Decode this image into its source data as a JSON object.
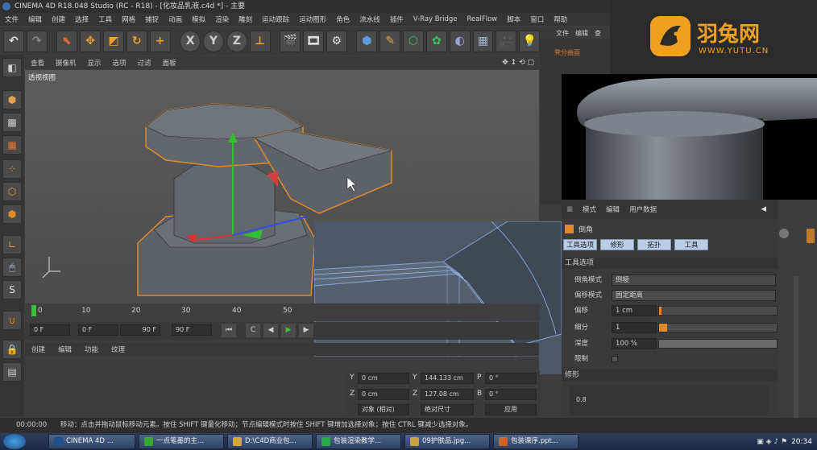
{
  "title": "CINEMA 4D R18.048 Studio (RC - R18) - [化妆品乳液.c4d *] - 主要",
  "menubar": [
    "文件",
    "编辑",
    "创建",
    "选择",
    "工具",
    "网格",
    "捕捉",
    "动画",
    "模拟",
    "渲染",
    "雕刻",
    "运动跟踪",
    "运动图形",
    "角色",
    "流水线",
    "插件",
    "V-Ray Bridge",
    "RealFlow",
    "脚本",
    "窗口",
    "帮助"
  ],
  "toolbar": {
    "axis_x": "X",
    "axis_y": "Y",
    "axis_z": "Z"
  },
  "viewport": {
    "menu": [
      "查看",
      "摄像机",
      "显示",
      "选项",
      "过滤",
      "面板"
    ],
    "label": "透视视图"
  },
  "timeline": {
    "ticks": [
      "0",
      "10",
      "20",
      "30",
      "40",
      "50"
    ],
    "start_frame": "0 F",
    "current_frame": "0 F",
    "range_end": "90 F",
    "end_frame": "90 F"
  },
  "material_bar": [
    "创建",
    "编辑",
    "功能",
    "纹理"
  ],
  "coords": {
    "y_pos": "144.133 cm",
    "z_pos": "127.08 cm",
    "y_size": "0 cm",
    "z_size": "0 cm",
    "p_rot": "0 °",
    "b_rot": "0 °",
    "y_label": "Y",
    "z_label": "Z",
    "p_label": "P",
    "b_label": "B",
    "mode_object": "对象 (相对)",
    "mode_size": "绝对尺寸",
    "apply": "应用"
  },
  "object_panel": {
    "menu": [
      "文件",
      "编辑",
      "查"
    ],
    "item": "凳分曲面"
  },
  "logo": {
    "name": "羽兔网",
    "url": "WWW.YUTU.CN"
  },
  "attributes": {
    "menu": [
      "模式",
      "编辑",
      "用户数据"
    ],
    "object_name": "倒角",
    "tabs": [
      "工具选项",
      "修形",
      "拓扑",
      "工具"
    ],
    "section": "工具选项",
    "bevel_mode_label": "倒角模式",
    "bevel_mode_value": "倒棱",
    "offset_mode_label": "偏移模式",
    "offset_mode_value": "固定距离",
    "offset_label": "偏移",
    "offset_value": "1 cm",
    "subdiv_label": "细分",
    "subdiv_value": "1",
    "depth_label": "深度",
    "depth_value": "100 %",
    "limit_label": "限制",
    "shape_section": "修形",
    "graph_tick": "0.8"
  },
  "statusbar": {
    "time": "00:00:00",
    "message": "移动：点击并拖动鼠标移动元素。按住 SHIFT 键量化移动；节点编辑模式时按住 SHIFT 键增加选择对象；按住 CTRL 键减少选择对象。"
  },
  "taskbar": {
    "items": [
      {
        "label": "CINEMA 4D ...",
        "color": "#1f4f8f"
      },
      {
        "label": "一点笔墨的主...",
        "color": "#3aa535"
      },
      {
        "label": "D:\\C4D商业包...",
        "color": "#d4a83a"
      },
      {
        "label": "包装渲染教学...",
        "color": "#2aa84a"
      },
      {
        "label": "09护肤品.jpg...",
        "color": "#c9a23a"
      },
      {
        "label": "包装课序.ppt...",
        "color": "#d0612a"
      }
    ],
    "clock": "20:34"
  },
  "colors": {
    "accent_orange": "#e08a2a",
    "tab_blue": "#b9cde6",
    "model_gray": "#6b6f76"
  }
}
